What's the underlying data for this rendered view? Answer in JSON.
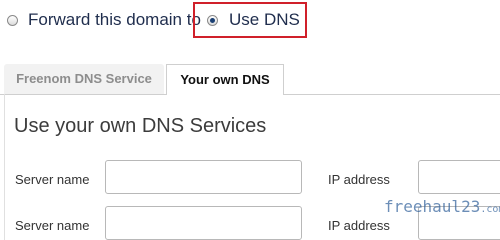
{
  "options": {
    "forward_label": "Forward this domain to",
    "use_dns_label": "Use DNS",
    "selected": "use_dns"
  },
  "tabs": [
    {
      "label": "Freenom DNS Service",
      "active": false
    },
    {
      "label": "Your own DNS",
      "active": true
    }
  ],
  "section": {
    "title": "Use your own DNS Services"
  },
  "rows": [
    {
      "server_label": "Server name",
      "server_value": "",
      "ip_label": "IP address",
      "ip_value": ""
    },
    {
      "server_label": "Server name",
      "server_value": "",
      "ip_label": "IP address",
      "ip_value": ""
    }
  ],
  "watermark": {
    "text": "freehaul23",
    "suffix": ".com"
  },
  "colors": {
    "highlight": "#d0202a",
    "radio_selected": "#1a3f73",
    "watermark": "#2f5f9a"
  }
}
